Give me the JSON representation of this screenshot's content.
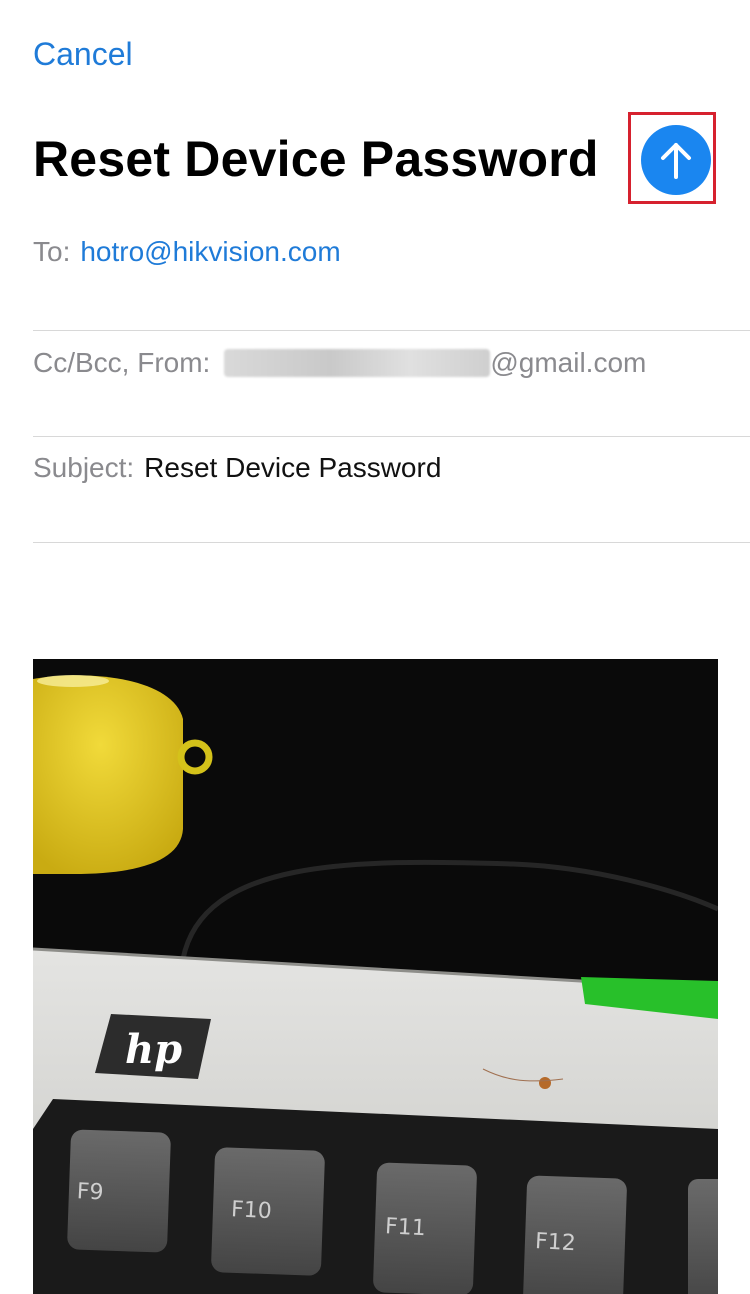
{
  "header": {
    "cancel_label": "Cancel",
    "title": "Reset Device Password",
    "send_icon": "arrow-up-icon"
  },
  "fields": {
    "to_label": "To:",
    "to_value": "hotro@hikvision.com",
    "ccbcc_label": "Cc/Bcc, From:",
    "from_value_suffix": "@gmail.com",
    "subject_label": "Subject:",
    "subject_value": "Reset Device Password"
  },
  "attachment": {
    "logo_text": "hp",
    "keys": [
      "F9",
      "F10",
      "F11",
      "F12"
    ]
  },
  "colors": {
    "accent": "#1f7bd8",
    "send_button": "#1a86f0",
    "highlight_box": "#d6212e"
  }
}
